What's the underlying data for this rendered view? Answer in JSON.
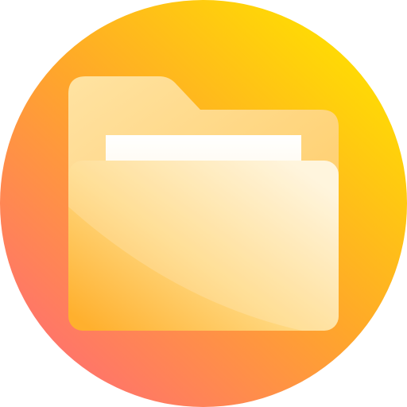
{
  "icon": {
    "name": "folder-icon",
    "badge_shape": "circle",
    "colors": {
      "badge_top_right": "#FFE000",
      "badge_mid": "#FFA62B",
      "badge_bottom_left": "#FF7070",
      "folder_back": "#FFE6A8",
      "folder_back_shade": "#FFC966",
      "paper": "#FFF8E8",
      "folder_front_light": "#FFF3D6",
      "folder_front_mid": "#FFD77E",
      "folder_front_dark": "#FFB02E"
    }
  }
}
